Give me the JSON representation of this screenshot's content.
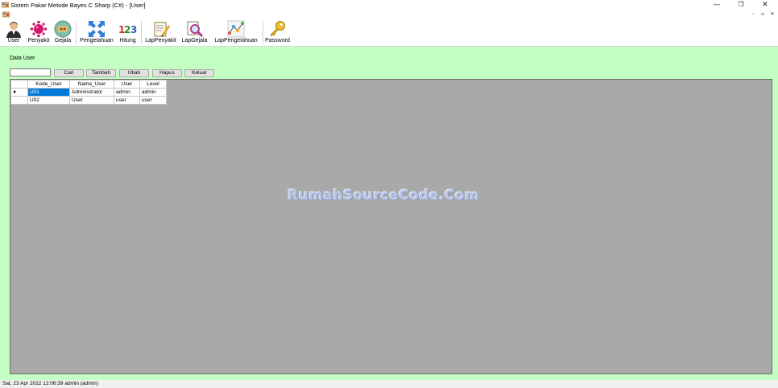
{
  "window": {
    "title": "Sistem Pakar Metode Bayes C Sharp (C#) - [User]",
    "controls": {
      "minimize": "—",
      "restore": "❐",
      "close": "✕"
    }
  },
  "mdi_controls": {
    "minimize": "–",
    "restore": "▫",
    "close": "✕"
  },
  "toolbar": {
    "items": [
      {
        "label": "User",
        "icon": "user-avatar-icon"
      },
      {
        "label": "Penyakit",
        "icon": "virus-icon"
      },
      {
        "label": "Gejala",
        "icon": "symptom-icon"
      },
      {
        "label": "Pengetahuan",
        "icon": "knowledge-icon"
      },
      {
        "label": "Hitung",
        "icon": "numbers-123-icon"
      },
      {
        "label": "LapPenyakit",
        "icon": "report-pencil-icon"
      },
      {
        "label": "LapGejala",
        "icon": "report-magnifier-icon"
      },
      {
        "label": "LapPengetahuan",
        "icon": "network-graph-icon"
      },
      {
        "label": "Password",
        "icon": "key-icon"
      }
    ]
  },
  "form": {
    "title": "Data User",
    "search": {
      "value": "",
      "placeholder": ""
    },
    "buttons": {
      "cari": "Cari",
      "tambah": "Tambah",
      "ubah": "Ubah",
      "hapus": "Hapus",
      "keluar": "Keluar"
    }
  },
  "grid": {
    "columns": [
      "Kode_User",
      "Nama_User",
      "User",
      "Level"
    ],
    "rows": [
      [
        "U01",
        "Administrator",
        "admin",
        "admin"
      ],
      [
        "U02",
        "User",
        "user",
        "user"
      ]
    ],
    "selected_row": 0
  },
  "watermark": "RumahSourceCode.Com",
  "status": {
    "text": "Sat, 23 Apr 2022 12:06:39  admin (admin)"
  },
  "colors": {
    "mdi_background": "#c3ffc2",
    "grid_background": "#a9a9a9",
    "selection": "#0078d7"
  }
}
